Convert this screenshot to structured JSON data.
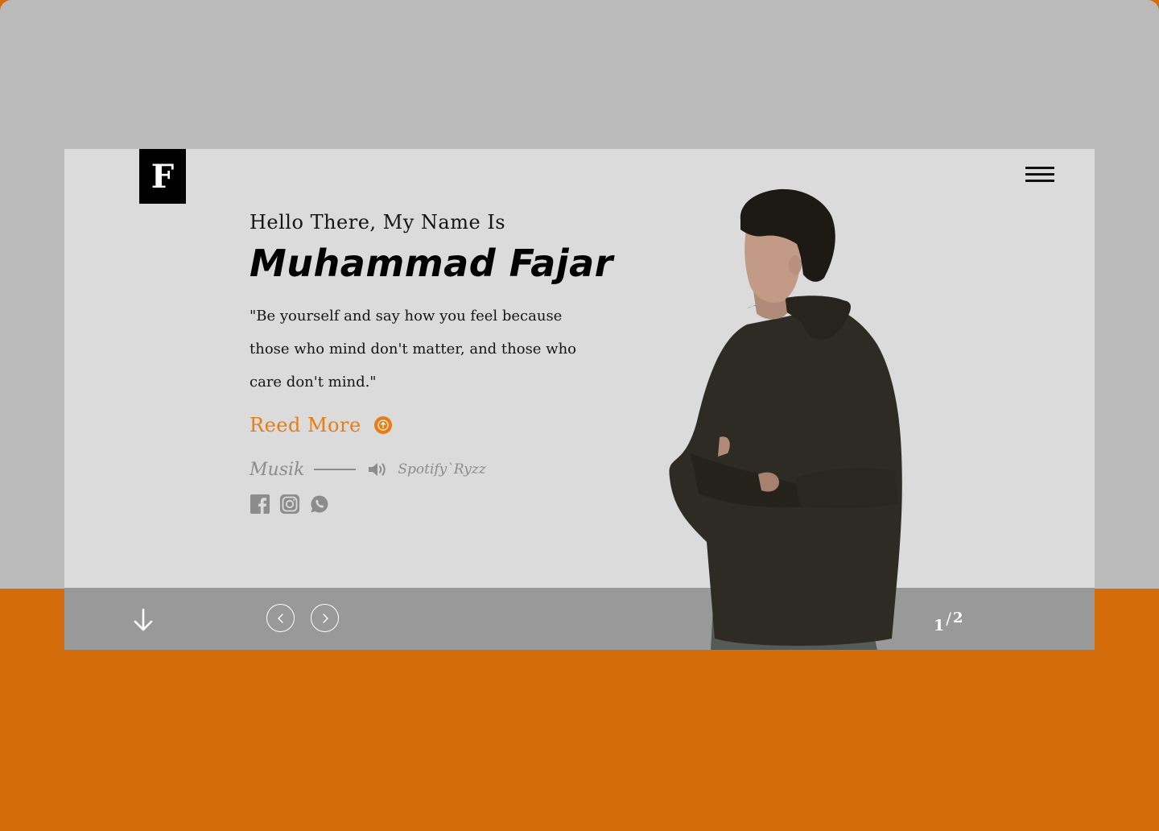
{
  "brand": {
    "logo_letter": "F"
  },
  "hero": {
    "greeting": "Hello There, My Name Is",
    "name": "Muhammad Fajar",
    "quote": "\"Be yourself and say how you feel because those who mind don't matter, and those who care don't mind.\"",
    "read_more_label": "Reed More"
  },
  "music": {
    "label": "Musik",
    "track": "Spotify`Ryzz"
  },
  "socials": [
    {
      "icon": "facebook-icon"
    },
    {
      "icon": "instagram-icon"
    },
    {
      "icon": "whatsapp-icon"
    }
  ],
  "pagination": {
    "current": "1",
    "separator": "/",
    "total": "2"
  },
  "colors": {
    "accent": "#e87c17",
    "page_top": "#bbbbbb",
    "page_bottom": "#d46c0c",
    "card": "#dbdbdb",
    "footer_bar": "#999999",
    "muted_text": "#8c8c8c"
  },
  "icons": {
    "menu": "hamburger-menu-icon",
    "scroll": "arrow-down-icon",
    "prev": "chevron-left-icon",
    "next": "chevron-right-icon",
    "read_more": "arrow-up-circle-icon",
    "sound": "speaker-icon"
  }
}
